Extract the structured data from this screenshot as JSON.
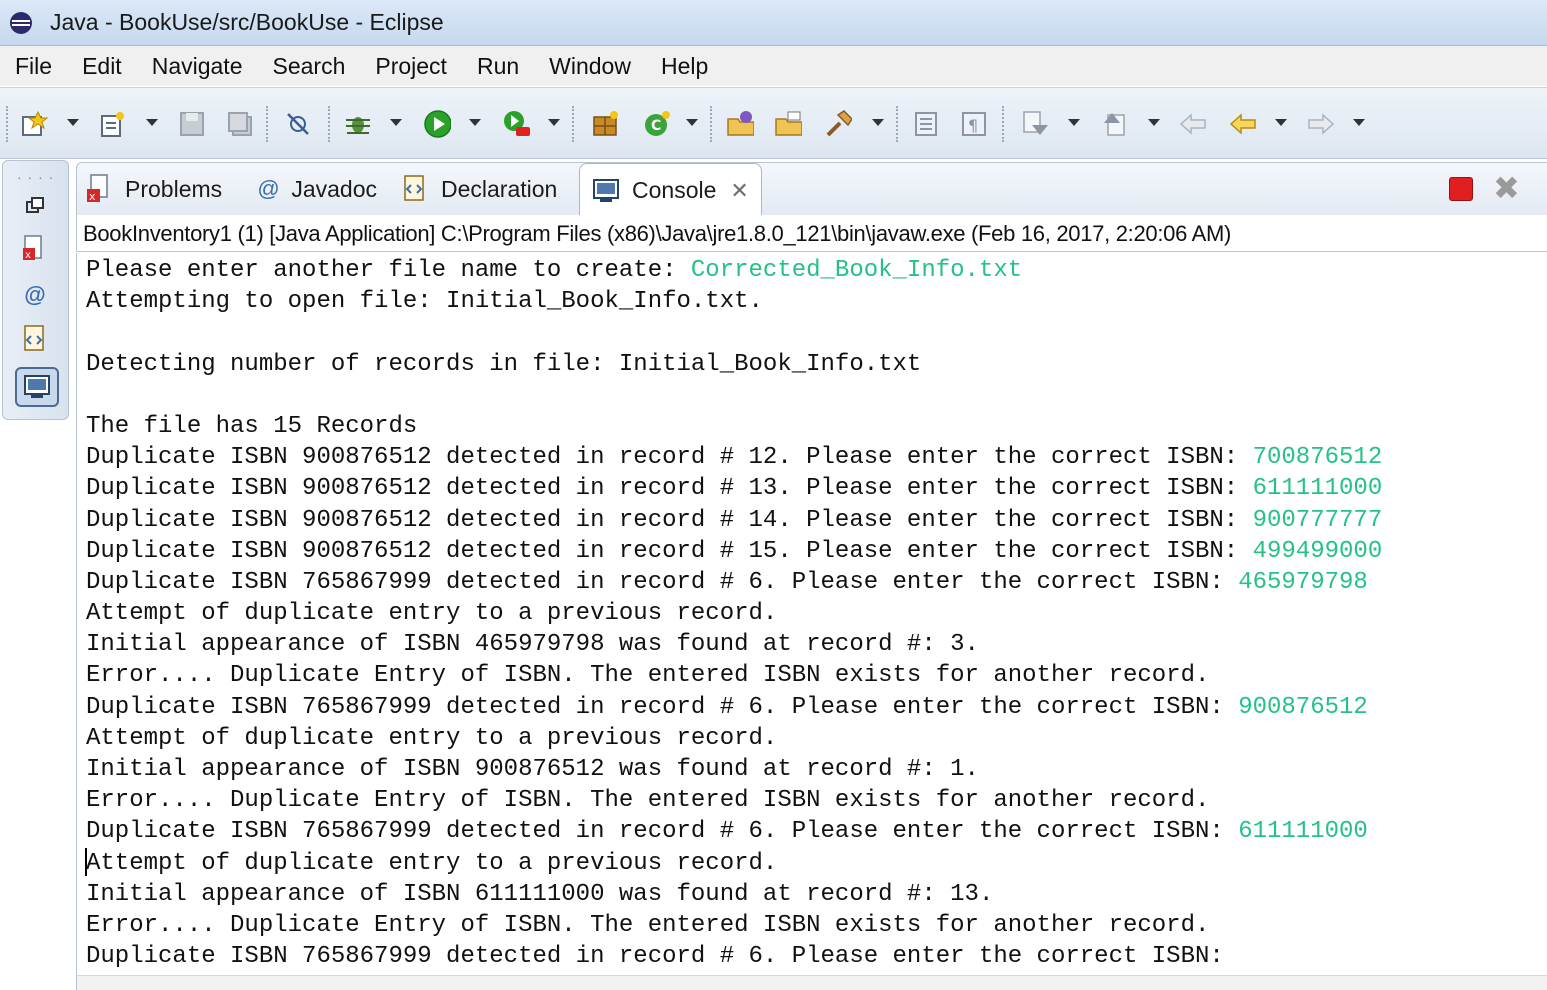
{
  "window": {
    "title": "Java - BookUse/src/BookUse - Eclipse"
  },
  "menu": [
    "File",
    "Edit",
    "Navigate",
    "Search",
    "Project",
    "Run",
    "Window",
    "Help"
  ],
  "toolbar": {
    "icons": [
      "new-wizard-icon",
      "new-file-icon",
      "save-icon",
      "save-all-icon",
      "skip-breakpoints-icon",
      "debug-icon",
      "run-icon",
      "run-external-icon",
      "new-java-project-icon",
      "new-java-class-icon",
      "open-type-icon",
      "open-task-icon",
      "search-icon",
      "toggle-block-icon",
      "show-whitespace-icon",
      "next-annotation-icon",
      "previous-annotation-icon",
      "last-edit-icon",
      "back-icon",
      "forward-icon"
    ]
  },
  "tabs": [
    {
      "label": "Problems",
      "icon": "problems-icon"
    },
    {
      "label": "Javadoc",
      "icon": "javadoc-icon"
    },
    {
      "label": "Declaration",
      "icon": "declaration-icon"
    },
    {
      "label": "Console",
      "icon": "console-icon",
      "active": true
    }
  ],
  "console": {
    "description": "BookInventory1 (1) [Java Application] C:\\Program Files (x86)\\Java\\jre1.8.0_121\\bin\\javaw.exe (Feb 16, 2017, 2:20:06 AM)",
    "lines": [
      {
        "text": "Please enter another file name to create: ",
        "input": "Corrected_Book_Info.txt"
      },
      {
        "text": "Attempting to open file: Initial_Book_Info.txt.",
        "input": ""
      },
      {
        "text": "",
        "input": ""
      },
      {
        "text": "Detecting number of records in file: Initial_Book_Info.txt",
        "input": ""
      },
      {
        "text": "",
        "input": ""
      },
      {
        "text": "The file has 15 Records",
        "input": ""
      },
      {
        "text": "Duplicate ISBN 900876512 detected in record # 12. Please enter the correct ISBN: ",
        "input": "700876512"
      },
      {
        "text": "Duplicate ISBN 900876512 detected in record # 13. Please enter the correct ISBN: ",
        "input": "611111000"
      },
      {
        "text": "Duplicate ISBN 900876512 detected in record # 14. Please enter the correct ISBN: ",
        "input": "900777777"
      },
      {
        "text": "Duplicate ISBN 900876512 detected in record # 15. Please enter the correct ISBN: ",
        "input": "499499000"
      },
      {
        "text": "Duplicate ISBN 765867999 detected in record # 6. Please enter the correct ISBN: ",
        "input": "465979798"
      },
      {
        "text": "Attempt of duplicate entry to a previous record.",
        "input": ""
      },
      {
        "text": "Initial appearance of ISBN 465979798 was found at record #: 3.",
        "input": ""
      },
      {
        "text": "Error.... Duplicate Entry of ISBN. The entered ISBN exists for another record.",
        "input": ""
      },
      {
        "text": "Duplicate ISBN 765867999 detected in record # 6. Please enter the correct ISBN: ",
        "input": "900876512"
      },
      {
        "text": "Attempt of duplicate entry to a previous record.",
        "input": ""
      },
      {
        "text": "Initial appearance of ISBN 900876512 was found at record #: 1.",
        "input": ""
      },
      {
        "text": "Error.... Duplicate Entry of ISBN. The entered ISBN exists for another record.",
        "input": ""
      },
      {
        "text": "Duplicate ISBN 765867999 detected in record # 6. Please enter the correct ISBN: ",
        "input": "611111000"
      },
      {
        "text": "Attempt of duplicate entry to a previous record.",
        "input": ""
      },
      {
        "text": "Initial appearance of ISBN 611111000 was found at record #: 13.",
        "input": ""
      },
      {
        "text": "Error.... Duplicate Entry of ISBN. The entered ISBN exists for another record.",
        "input": ""
      },
      {
        "text": "Duplicate ISBN 765867999 detected in record # 6. Please enter the correct ISBN:",
        "input": ""
      }
    ]
  },
  "colors": {
    "console_input": "#25c285",
    "stop_button": "#e02020",
    "titlebar": "#c6d9ef"
  }
}
